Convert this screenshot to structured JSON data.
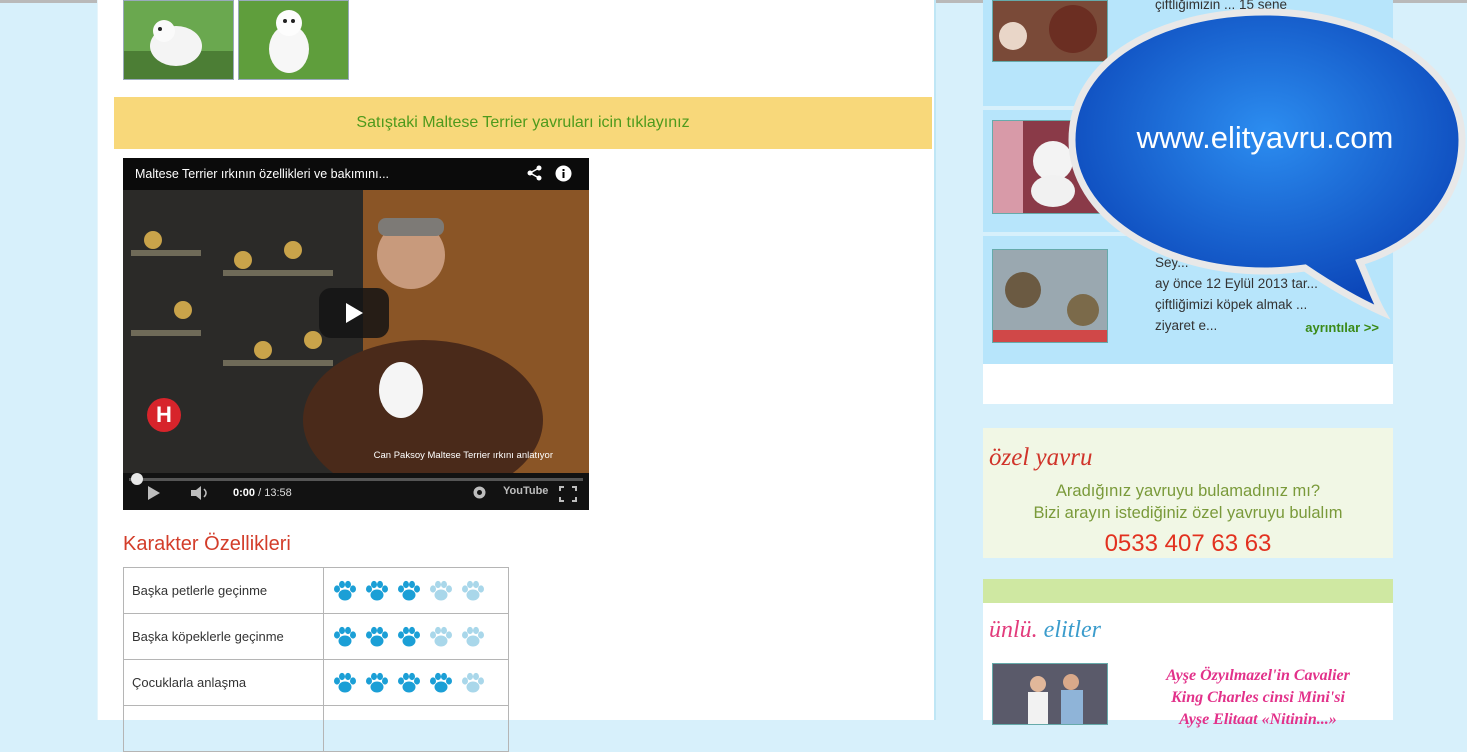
{
  "banner": {
    "text": "Satıştaki Maltese Terrier yavruları icin tıklayınız"
  },
  "video": {
    "title": "Maltese Terrier ırkının özellikleri ve bakımını...",
    "caption": "Can Paksoy Maltese Terrier ırkını anlatıyor",
    "time_current": "0:00",
    "time_total": "/ 13:58",
    "channel_logo": "H",
    "youtube_label": "YouTube",
    "icons": {
      "share": "share-icon",
      "info": "info-icon",
      "play": "play-icon",
      "volume": "volume-icon",
      "fullscreen": "fullscreen-icon",
      "settings": "settings-icon"
    },
    "progress_fraction": 0.0
  },
  "traits": {
    "title": "Karakter Özellikleri",
    "rows": [
      {
        "label": "Başka petlerle geçinme",
        "rating": 3,
        "max": 5
      },
      {
        "label": "Başka köpeklerle geçinme",
        "rating": 3,
        "max": 5
      },
      {
        "label": "Çocuklarla anlaşma",
        "rating": 4,
        "max": 5
      }
    ],
    "colors": {
      "active": "#1b9fd6",
      "inactive": "#a9d7ea"
    }
  },
  "sidebar": {
    "card1": {
      "text": "çiftliğimizin ... 15 sene"
    },
    "card3": {
      "text_lines": [
        "Sey...",
        "ay önce 12 Eylül 2013 tar...",
        "çiftliğimizi köpek almak ...",
        "ziyaret e..."
      ],
      "more": "ayrıntılar >>"
    },
    "ozel": {
      "title": "özel yavru",
      "line1": "Aradığınız yavruyu bulamadınız mı?",
      "line2": "Bizi arayın istediğiniz özel yavruyu bulalım",
      "phone": "0533 407 63 63"
    },
    "unlu": {
      "title_a": "ünlü.",
      "title_b": " elitler",
      "text_lines": [
        "Ayşe Özyılmazel'in Cavalier",
        "King Charles cinsi Mini'si",
        "Ayşe Elitaat «Nitinin...»"
      ]
    }
  },
  "bubble": {
    "text": "www.elityavru.com"
  },
  "colors": {
    "page_bg": "#d7f0fb",
    "banner_bg": "#f8d87a",
    "banner_text": "#4e9a1c",
    "accent_red": "#d33d2a",
    "bubble_blue": "#1565d8"
  }
}
